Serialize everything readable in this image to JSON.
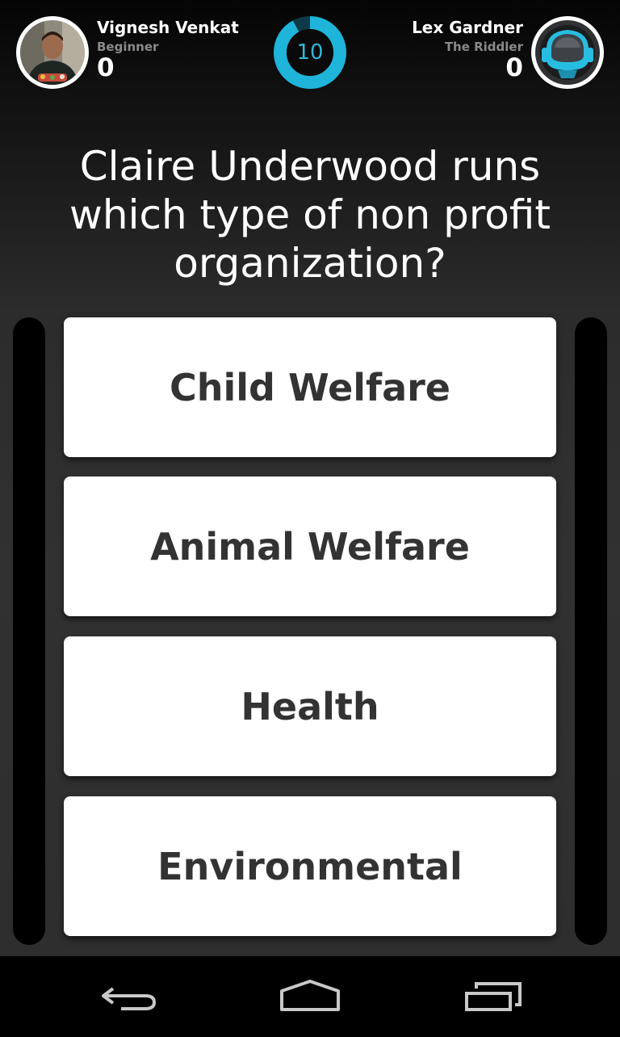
{
  "players": {
    "left": {
      "name": "Vignesh Venkat",
      "rank": "Beginner",
      "score": "0",
      "avatar": "user-photo"
    },
    "right": {
      "name": "Lex Gardner",
      "rank": "The Riddler",
      "score": "0",
      "avatar": "robot-helmet"
    }
  },
  "timer": {
    "value": "10",
    "progress": 0.92,
    "color": "#1fb4d9"
  },
  "question": "Claire Underwood runs which type of non profit organization?",
  "answers": [
    "Child Welfare",
    "Animal Welfare",
    "Health",
    "Environmental"
  ],
  "navigation": {
    "icons": [
      "back-icon",
      "home-icon",
      "recent-apps-icon"
    ]
  }
}
